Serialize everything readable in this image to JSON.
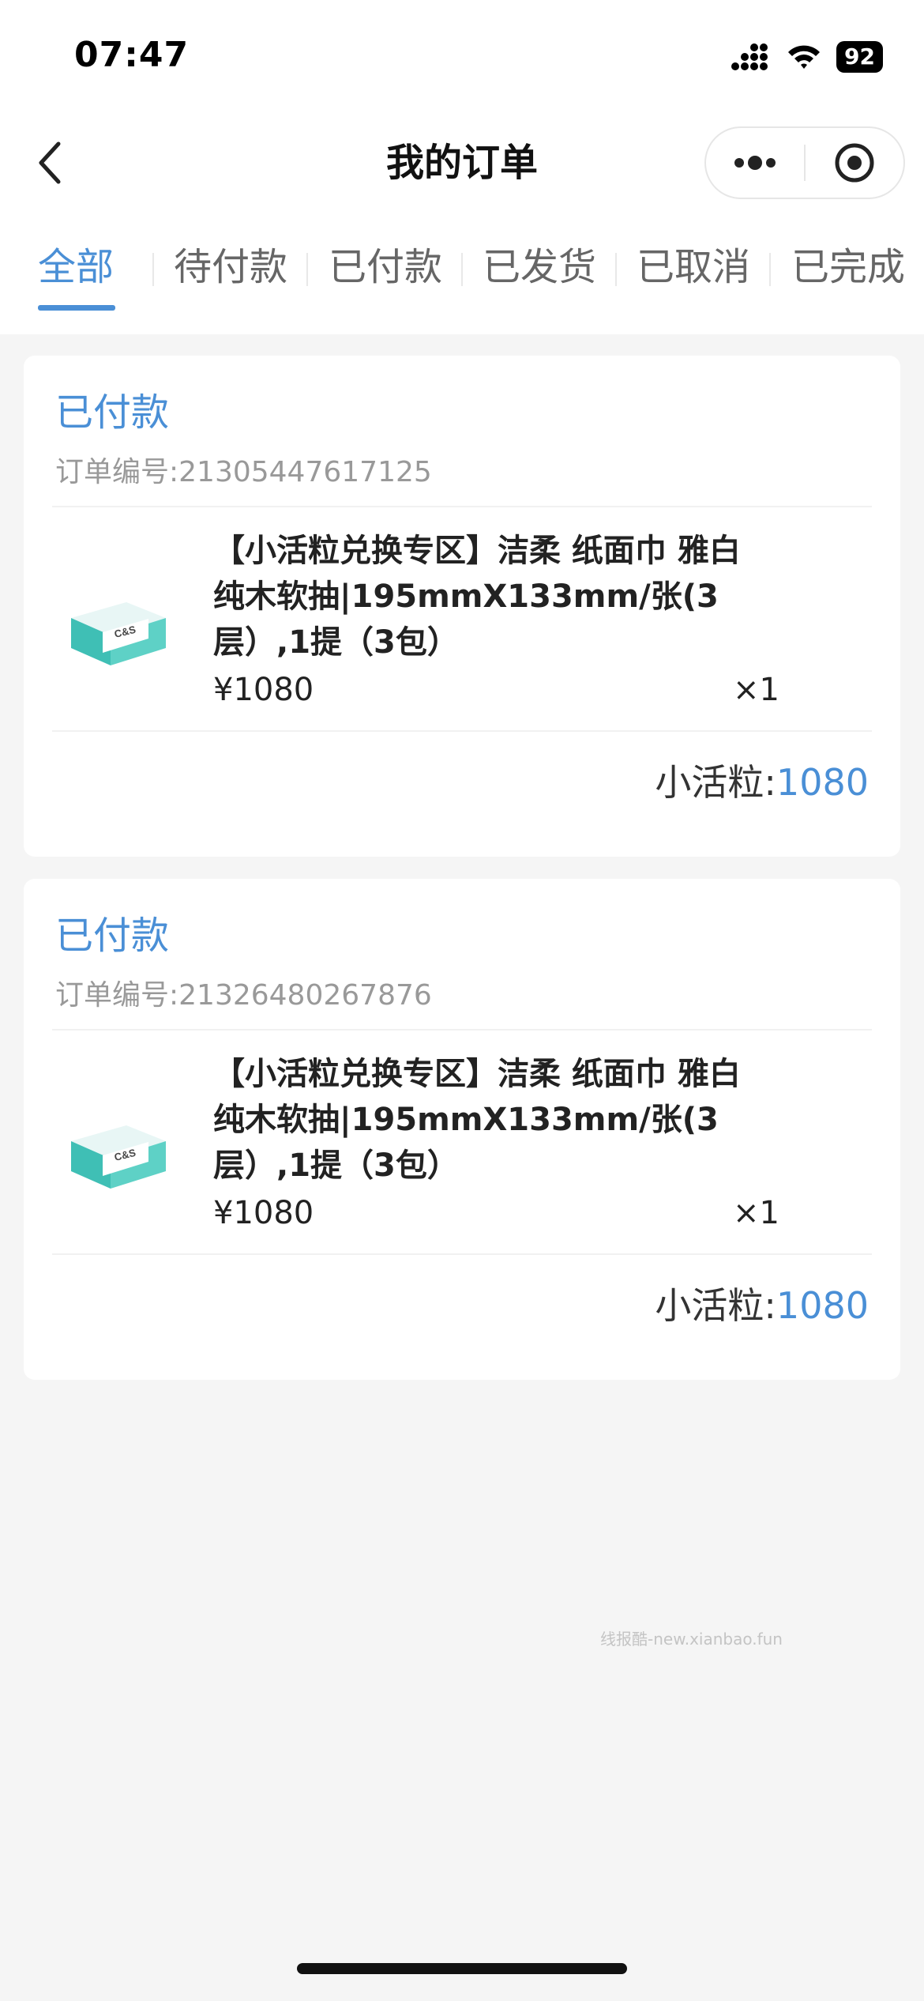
{
  "status_bar": {
    "time": "07:47",
    "battery": "92"
  },
  "nav": {
    "title": "我的订单"
  },
  "tabs": [
    {
      "label": "全部",
      "active": true
    },
    {
      "label": "待付款",
      "active": false
    },
    {
      "label": "已付款",
      "active": false
    },
    {
      "label": "已发货",
      "active": false
    },
    {
      "label": "已取消",
      "active": false
    },
    {
      "label": "已完成",
      "active": false
    }
  ],
  "orders": [
    {
      "status": "已付款",
      "order_no": "订单编号:21305447617125",
      "product": {
        "name_line1": "【小活粒兑换专区】洁柔 纸面巾 雅白",
        "name_line2": "纯木软抽|195mmX133mm/张(3",
        "name_line3": "层）,1提（3包）",
        "price": "¥1080",
        "qty": "×1"
      },
      "total_label": "小活粒:",
      "total_value": "1080"
    },
    {
      "status": "已付款",
      "order_no": "订单编号:21326480267876",
      "product": {
        "name_line1": "【小活粒兑换专区】洁柔 纸面巾 雅白",
        "name_line2": "纯木软抽|195mmX133mm/张(3",
        "name_line3": "层）,1提（3包）",
        "price": "¥1080",
        "qty": "×1"
      },
      "total_label": "小活粒:",
      "total_value": "1080"
    }
  ],
  "watermark": "线报酷-new.xianbao.fun",
  "colors": {
    "accent": "#4a8fd6",
    "background": "#f5f5f5"
  }
}
